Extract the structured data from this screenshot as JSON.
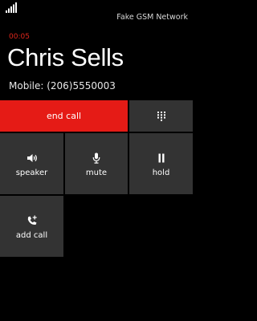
{
  "status_bar": {
    "network": "Fake GSM Network",
    "signal_icon": "signal-bars-icon"
  },
  "call": {
    "timer": "00:05",
    "caller_name": "Chris Sells",
    "caller_number": "Mobile: (206)5550003"
  },
  "actions": {
    "end_call": "end call",
    "keypad_icon": "keypad-icon",
    "speaker": "speaker",
    "mute": "mute",
    "hold": "hold",
    "add_call": "add call"
  },
  "colors": {
    "background": "#000000",
    "end_call": "#e51b16",
    "tile": "#333333",
    "timer": "#e0261c"
  }
}
